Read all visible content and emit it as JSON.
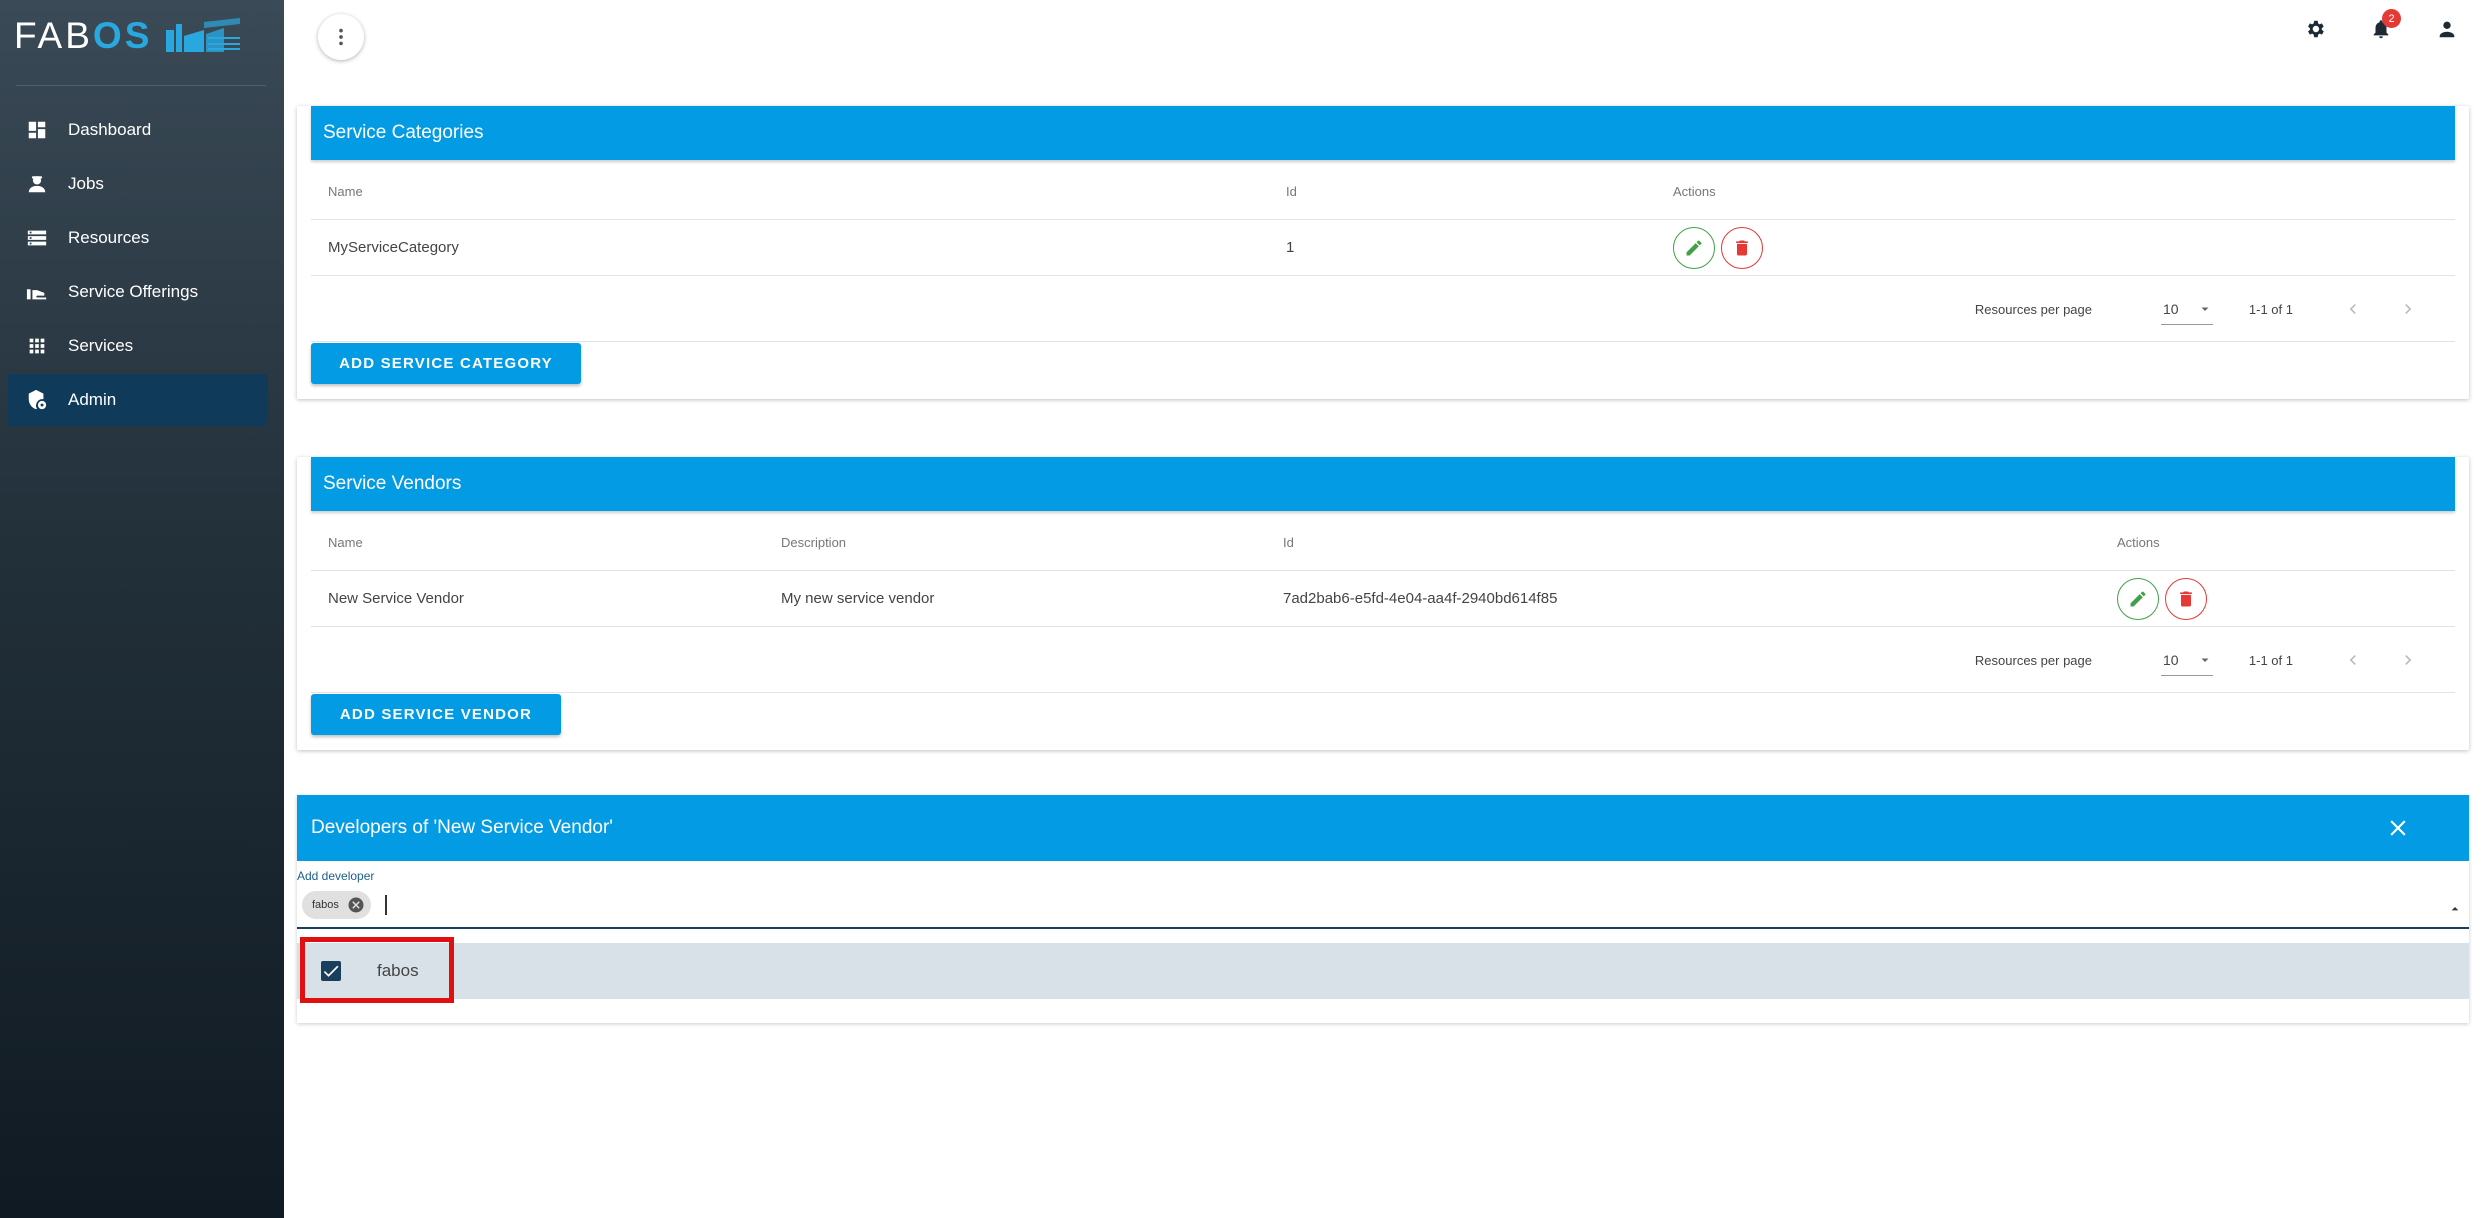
{
  "brand": {
    "logo_prefix": "FAB",
    "logo_suffix": "OS"
  },
  "sidebar": {
    "items": [
      {
        "label": "Dashboard",
        "icon": "dashboard-icon"
      },
      {
        "label": "Jobs",
        "icon": "worker-icon"
      },
      {
        "label": "Resources",
        "icon": "storage-icon"
      },
      {
        "label": "Service Offerings",
        "icon": "hand-offer-icon"
      },
      {
        "label": "Services",
        "icon": "apps-grid-icon"
      },
      {
        "label": "Admin",
        "icon": "admin-shield-icon",
        "active": true
      }
    ]
  },
  "topbar": {
    "notification_count": "2"
  },
  "service_categories": {
    "title": "Service Categories",
    "columns": [
      "Name",
      "Id",
      "Actions"
    ],
    "rows": [
      {
        "name": "MyServiceCategory",
        "id": "1"
      }
    ],
    "paginator": {
      "label": "Resources per page",
      "page_size": "10",
      "range": "1-1 of 1"
    },
    "add_button": "ADD SERVICE CATEGORY"
  },
  "service_vendors": {
    "title": "Service Vendors",
    "columns": [
      "Name",
      "Description",
      "Id",
      "Actions"
    ],
    "rows": [
      {
        "name": "New Service Vendor",
        "description": "My new service vendor",
        "id": "7ad2bab6-e5fd-4e04-aa4f-2940bd614f85"
      }
    ],
    "paginator": {
      "label": "Resources per page",
      "page_size": "10",
      "range": "1-1 of 1"
    },
    "add_button": "ADD SERVICE VENDOR"
  },
  "developers": {
    "title": "Developers of 'New Service Vendor'",
    "field_label": "Add developer",
    "chips": [
      "fabos"
    ],
    "options": [
      {
        "label": "fabos",
        "checked": true
      }
    ]
  },
  "colors": {
    "accent": "#049be5",
    "edit": "#43a047",
    "delete": "#e53935",
    "highlight": "#e01010"
  }
}
